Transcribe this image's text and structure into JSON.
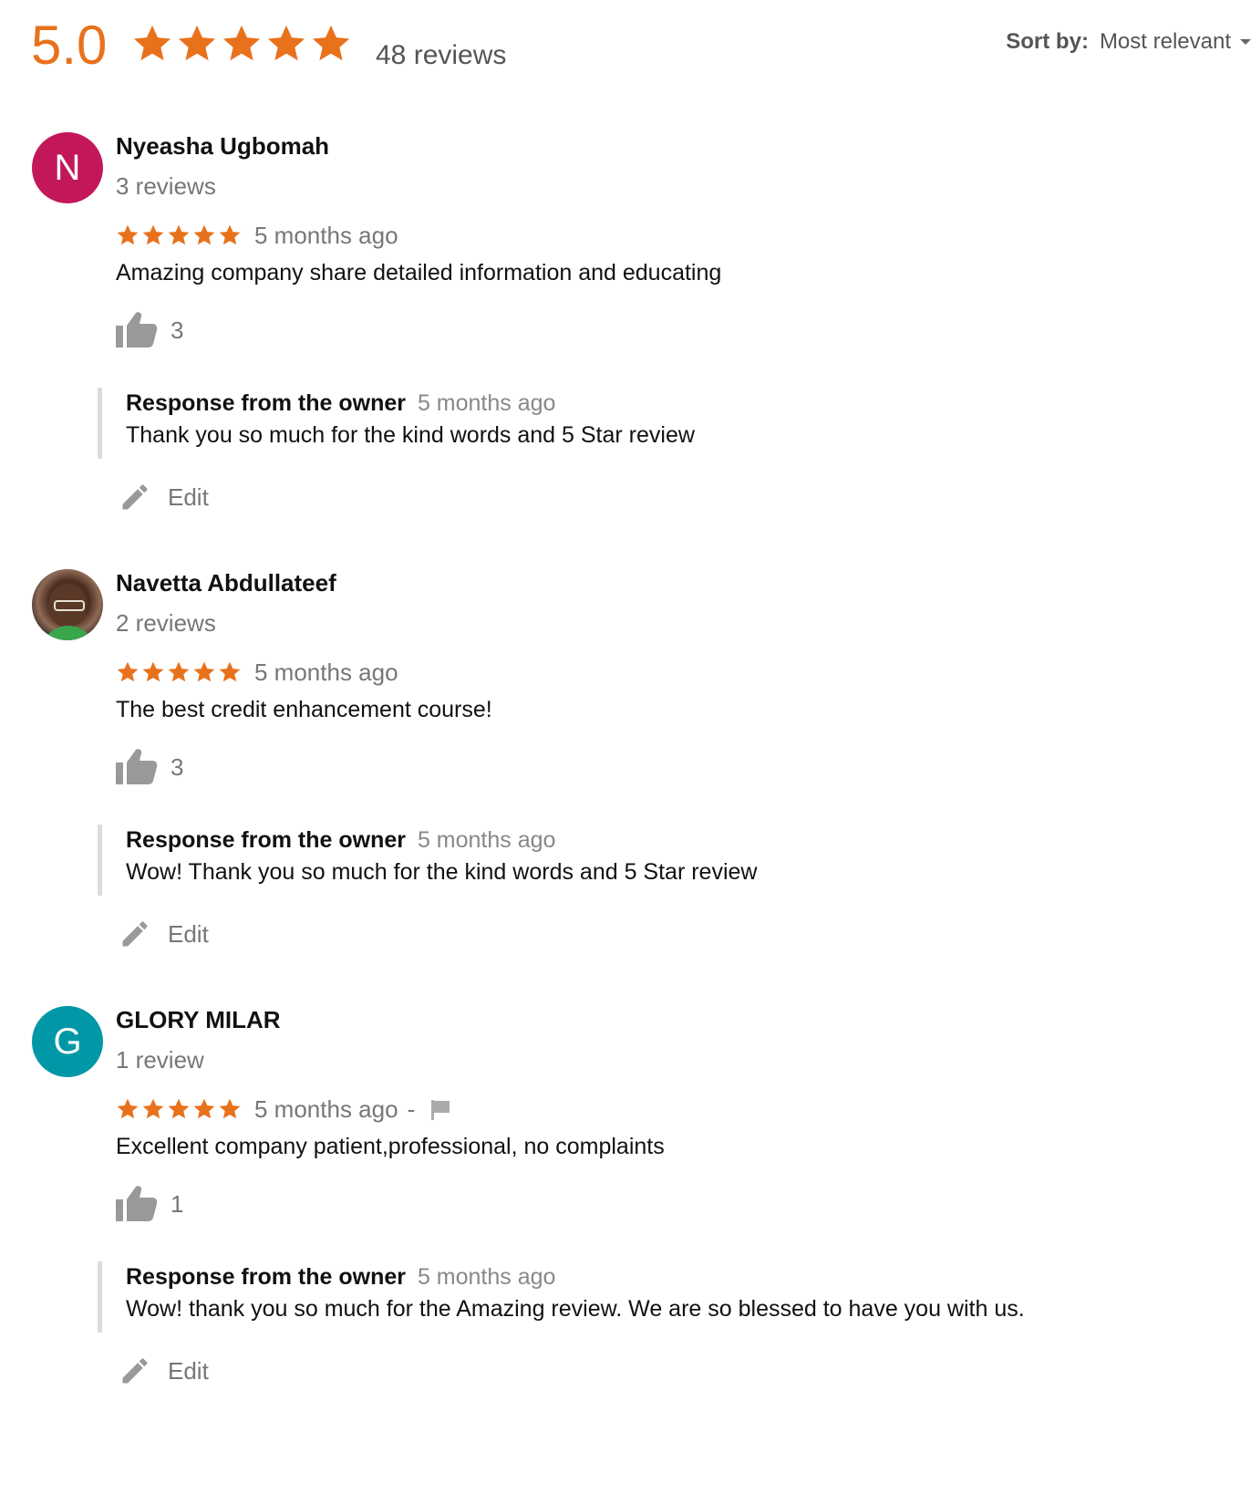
{
  "summary": {
    "score": "5.0",
    "stars": 5,
    "review_count": "48 reviews",
    "star_color": "#e8711c"
  },
  "sort": {
    "label": "Sort by:",
    "value": "Most relevant"
  },
  "icons": {
    "star": "star-icon",
    "thumb": "thumbs-up-icon",
    "pencil": "pencil-icon",
    "flag": "flag-icon"
  },
  "reviews": [
    {
      "avatar_letter": "N",
      "avatar_color": "#c2185b",
      "name": "Nyeasha Ugbomah",
      "count": "3 reviews",
      "rating": 5,
      "time": "5 months ago",
      "text": "Amazing company share detailed information and educating",
      "likes": "3",
      "response_label": "Response from the owner",
      "response_time": "5 months ago",
      "response_text": "Thank you so much for the kind words and 5 Star review",
      "edit_label": "Edit"
    },
    {
      "avatar_letter": "",
      "avatar_color": "#5a3828",
      "name": "Navetta Abdullateef",
      "count": "2 reviews",
      "rating": 5,
      "time": "5 months ago",
      "text": "The best credit enhancement course!",
      "likes": "3",
      "response_label": "Response from the owner",
      "response_time": "5 months ago",
      "response_text": "Wow! Thank you so much for the kind words and 5 Star review",
      "edit_label": "Edit"
    },
    {
      "avatar_letter": "G",
      "avatar_color": "#0097a7",
      "name": "GLORY MILAR",
      "count": "1 review",
      "rating": 5,
      "time": "5 months ago",
      "separator": "-",
      "text": "Excellent company patient,professional, no complaints",
      "likes": "1",
      "response_label": "Response from the owner",
      "response_time": "5 months ago",
      "response_text": "Wow! thank you so much for the Amazing review. We are so blessed to have you with us.",
      "edit_label": "Edit"
    }
  ]
}
